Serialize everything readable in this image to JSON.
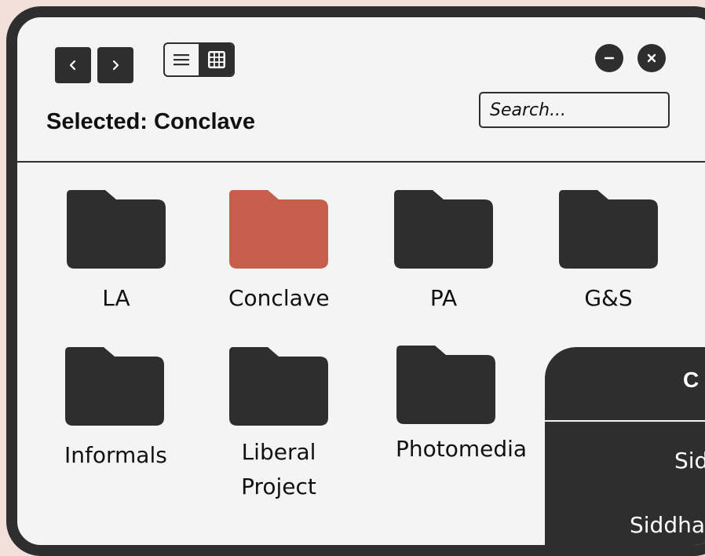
{
  "toolbar": {
    "back_icon": "chevron-left-icon",
    "forward_icon": "chevron-right-icon",
    "list_view_icon": "list-icon",
    "grid_view_icon": "grid-icon",
    "active_view": "grid",
    "minimize_icon": "minus-icon",
    "close_icon": "close-icon"
  },
  "header": {
    "selected_label": "Selected: Conclave",
    "search_placeholder": "Search..."
  },
  "folders": [
    {
      "label": "LA",
      "selected": false
    },
    {
      "label": "Conclave",
      "selected": true
    },
    {
      "label": "PA",
      "selected": false
    },
    {
      "label": "G&S",
      "selected": false
    },
    {
      "label": "Informals",
      "selected": false
    },
    {
      "label": "Liberal\nProject",
      "selected": false
    },
    {
      "label": "Photomedia",
      "selected": false
    }
  ],
  "panel": {
    "title": "C",
    "items": [
      "Sid",
      "Siddha"
    ]
  },
  "colors": {
    "folder": "#2e2e2e",
    "folder_selected": "#c55e4c",
    "background": "#f2e0da",
    "window": "#f4f4f4",
    "frame": "#2e2e2e"
  }
}
